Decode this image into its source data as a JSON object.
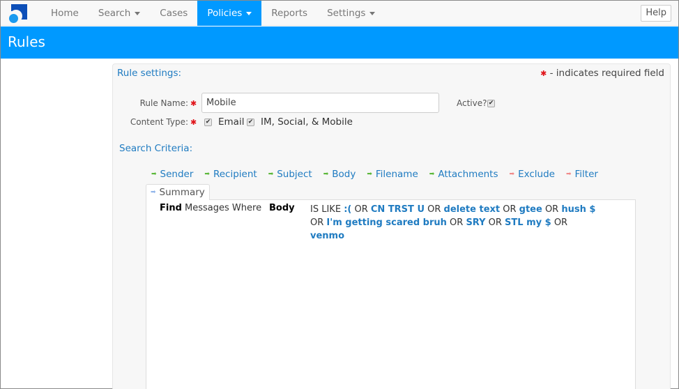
{
  "nav": {
    "items": [
      {
        "label": "Home",
        "dropdown": false,
        "active": false
      },
      {
        "label": "Search",
        "dropdown": true,
        "active": false
      },
      {
        "label": "Cases",
        "dropdown": false,
        "active": false
      },
      {
        "label": "Policies",
        "dropdown": true,
        "active": true
      },
      {
        "label": "Reports",
        "dropdown": false,
        "active": false
      },
      {
        "label": "Settings",
        "dropdown": true,
        "active": false
      }
    ],
    "help_label": "Help"
  },
  "page": {
    "title": "Rules"
  },
  "rule_settings": {
    "title": "Rule settings:",
    "required_note": "- indicates required field",
    "rule_name_label": "Rule Name:",
    "rule_name_value": "Mobile",
    "active_label": "Active?",
    "active_checked": true,
    "content_type_label": "Content Type:",
    "content_types": [
      {
        "label": "Email",
        "checked": true
      },
      {
        "label": "IM, Social, & Mobile",
        "checked": true
      }
    ]
  },
  "search_criteria": {
    "title": "Search Criteria:",
    "tabs": [
      {
        "label": "Sender",
        "arrow": "green"
      },
      {
        "label": "Recipient",
        "arrow": "green"
      },
      {
        "label": "Subject",
        "arrow": "green"
      },
      {
        "label": "Body",
        "arrow": "green"
      },
      {
        "label": "Filename",
        "arrow": "green"
      },
      {
        "label": "Attachments",
        "arrow": "green"
      },
      {
        "label": "Exclude",
        "arrow": "red"
      },
      {
        "label": "Filter",
        "arrow": "red"
      }
    ],
    "summary_tab": "Summary",
    "summary": {
      "find_bold": "Find",
      "find_rest": "Messages Where",
      "field": "Body",
      "operator": "IS LIKE",
      "terms": [
        ":(",
        "CN TRST U",
        "delete text",
        "gtee",
        "hush $",
        "I'm getting scared bruh",
        "SRY",
        "STL my $",
        "venmo"
      ],
      "joiner": "OR"
    }
  },
  "colors": {
    "accent": "#0099ff",
    "link": "#1f7bc1",
    "required": "#e0141a"
  }
}
